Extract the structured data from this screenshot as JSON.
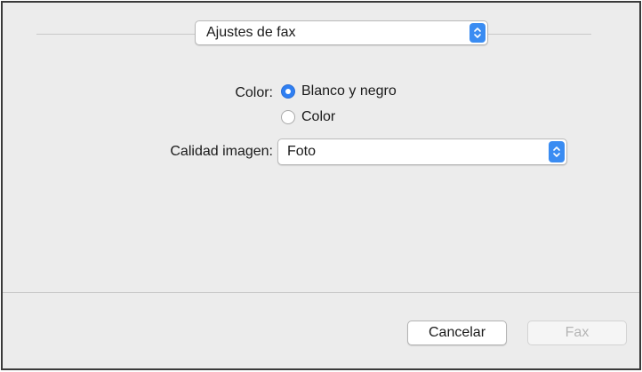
{
  "preset_popup": {
    "value": "Ajustes de fax"
  },
  "color": {
    "label": "Color:",
    "options": [
      {
        "label": "Blanco y negro",
        "selected": true
      },
      {
        "label": "Color",
        "selected": false
      }
    ]
  },
  "quality": {
    "label": "Calidad imagen:",
    "value": "Foto"
  },
  "buttons": {
    "cancel": "Cancelar",
    "fax": "Fax"
  },
  "colors": {
    "accent": "#3a8cf2",
    "dialog_bg": "#ececec"
  },
  "icons": {
    "stepper": "updown-chevron-icon"
  }
}
